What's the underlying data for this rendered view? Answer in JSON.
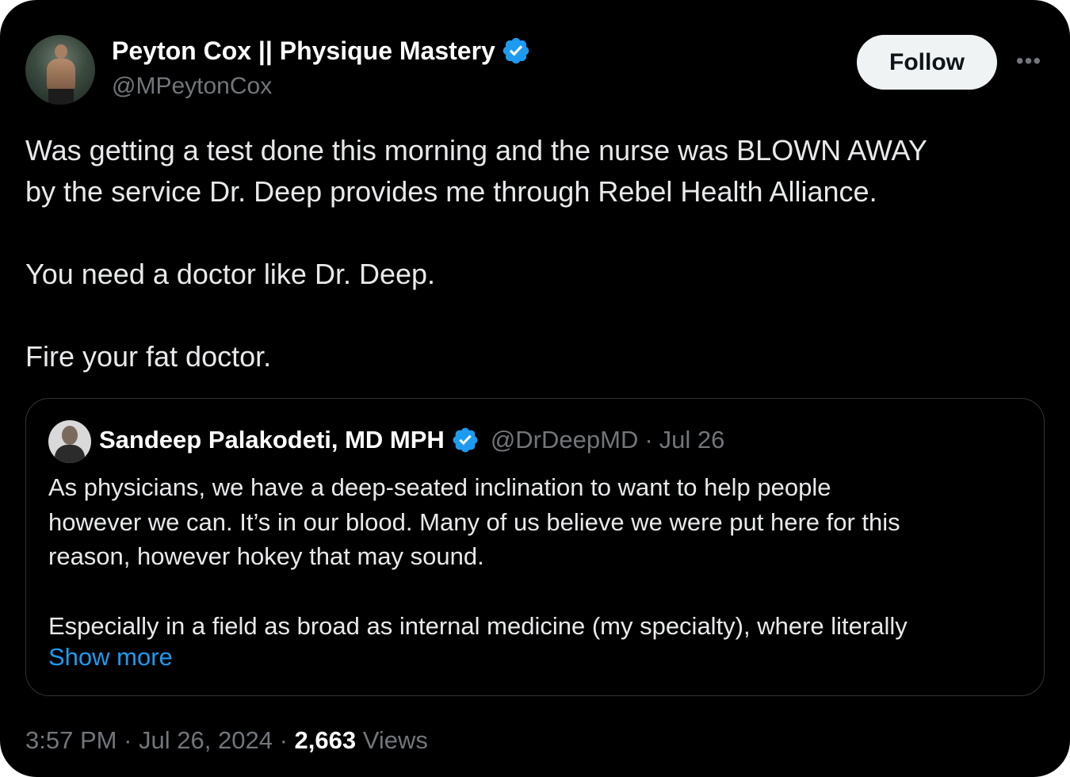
{
  "tweet": {
    "author": {
      "display_name": "Peyton Cox || Physique Mastery",
      "handle": "@MPeytonCox",
      "verified_icon": "verified-badge-icon"
    },
    "follow_label": "Follow",
    "more_label": "•••",
    "text_lines": [
      "Was getting a test done this morning and the nurse was BLOWN AWAY",
      "by the service Dr. Deep provides me through Rebel Health Alliance.",
      "You need a doctor like Dr. Deep.",
      "Fire your fat doctor."
    ],
    "quote": {
      "display_name": "Sandeep Palakodeti, MD MPH",
      "handle": "@DrDeepMD",
      "separator": "·",
      "date": "Jul 26",
      "text_lines": [
        "As physicians, we have a deep-seated inclination to want to help people",
        "however we can. It’s in our blood. Many of us believe we were put here for this",
        "reason, however hokey that may sound.",
        "Especially in a field as broad as internal medicine (my specialty), where literally"
      ],
      "show_more": "Show more"
    },
    "meta": {
      "time": "3:57 PM",
      "separator": "·",
      "date": "Jul 26, 2024",
      "separator2": "·",
      "views_count": "2,663",
      "views_label": "Views"
    }
  },
  "colors": {
    "background": "#000000",
    "text": "#e7e9ea",
    "secondary": "#71767b",
    "link": "#1d9bf0",
    "verified": "#1d9bf0",
    "follow_bg": "#eff3f4"
  }
}
